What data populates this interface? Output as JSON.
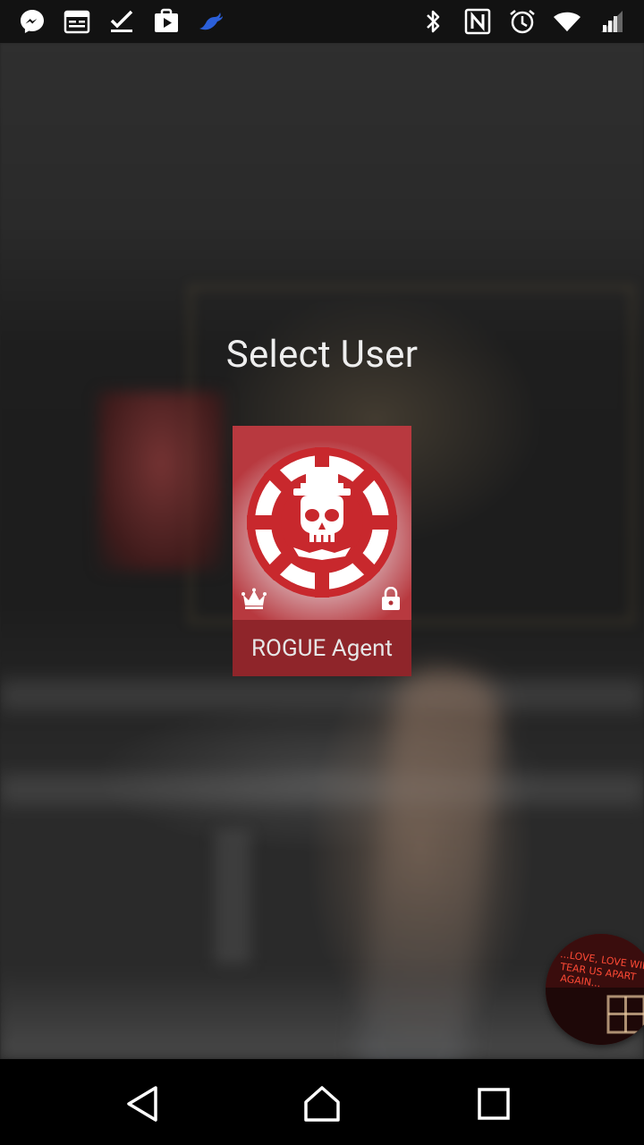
{
  "status_bar": {
    "left_icons": [
      "messenger-icon",
      "calendar-icon",
      "download-done-icon",
      "play-store-icon",
      "bird-icon"
    ],
    "right_icons": [
      "bluetooth-icon",
      "nfc-icon",
      "alarm-icon",
      "wifi-icon",
      "cell-signal-icon"
    ]
  },
  "screen": {
    "title": "Select User"
  },
  "users": [
    {
      "name": "ROGUE Agent",
      "is_owner": true,
      "is_locked": true,
      "avatar_icon": "division-rogue-skull-icon",
      "accent_color": "#c8282d"
    }
  ],
  "chat_head": {
    "text_lines": [
      "...LOVE, LOVE WILL",
      "TEAR US APART",
      "AGAIN..."
    ],
    "color": "#ff3b2a"
  },
  "nav_bar": {
    "buttons": [
      "back-icon",
      "home-icon",
      "recents-icon"
    ]
  }
}
